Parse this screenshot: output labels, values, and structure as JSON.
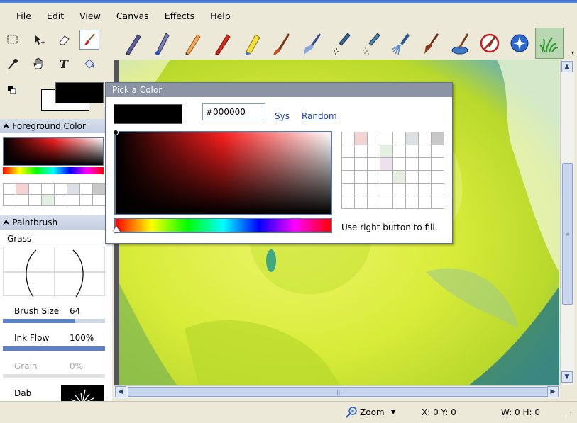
{
  "menu": [
    "File",
    "Edit",
    "View",
    "Canvas",
    "Effects",
    "Help"
  ],
  "colors": {
    "foreground": "#000000",
    "canvas_main": "#d8ec3a",
    "active_brush_bg": "#b9d7b2",
    "section_header": "#c8d3e6"
  },
  "toolbar": {
    "brushes": [
      {
        "icon": "pen-icon"
      },
      {
        "icon": "ink-pen-icon"
      },
      {
        "icon": "pencil-icon"
      },
      {
        "icon": "red-pencil-icon"
      },
      {
        "icon": "felt-marker-icon"
      },
      {
        "icon": "oil-brush-icon"
      },
      {
        "icon": "broad-brush-icon"
      },
      {
        "icon": "airbrush-icon"
      },
      {
        "icon": "spray-icon"
      },
      {
        "icon": "fan-brush-icon"
      },
      {
        "icon": "flat-brush-icon"
      },
      {
        "icon": "paint-bucket-brush-icon"
      },
      {
        "icon": "no-brush-icon"
      },
      {
        "icon": "star-brush-icon"
      },
      {
        "icon": "grass-brush-icon",
        "active": true
      }
    ]
  },
  "tools": [
    {
      "icon": "rectangle-select-icon"
    },
    {
      "icon": "move-arrow-icon"
    },
    {
      "icon": "eraser-icon"
    },
    {
      "icon": "paintbrush-icon",
      "active": true
    },
    {
      "icon": "eyedropper-icon"
    },
    {
      "icon": "hand-pan-icon"
    },
    {
      "icon": "text-tool-icon"
    },
    {
      "icon": "fill-bucket-icon"
    }
  ],
  "sections": {
    "foreground": {
      "label": "Foreground Color"
    },
    "paintbrush": {
      "label": "Paintbrush",
      "brush_name": "Grass",
      "params": [
        {
          "label": "Brush Size",
          "value": "64",
          "level": 0.7
        },
        {
          "label": "Ink Flow",
          "value": "100%",
          "level": 1.0
        },
        {
          "label": "Grain",
          "value": "0%",
          "level": 0.0,
          "disabled": true
        },
        {
          "label": "Dab",
          "value": ""
        }
      ]
    }
  },
  "picker": {
    "title": "Pick a Color",
    "hex_value": "#000000",
    "sys_label": "Sys",
    "random_label": "Random",
    "hint": "Use right button to fill."
  },
  "status": {
    "zoom_label": "Zoom",
    "coords": "X: 0 Y: 0",
    "dims": "W: 0 H: 0"
  }
}
